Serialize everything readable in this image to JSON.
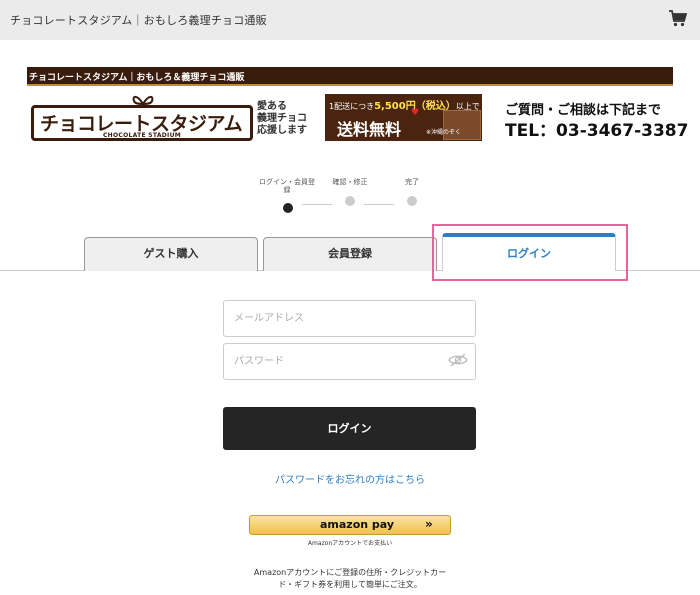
{
  "header": {
    "title": "チョコレートスタジアム｜おもしろ義理チョコ通販",
    "cart_icon": "cart-icon"
  },
  "brand": {
    "bar_text": "チョコレートスタジアム｜おもしろ＆義理チョコ通販",
    "logo_text": "チョコレートスタジアム",
    "logo_sub": "CHOCOLATE STADIUM",
    "tagline": [
      "愛ある",
      "義理チョコ",
      "応援します"
    ],
    "banner_line1": "1配送につき",
    "banner_amount": "5,500円（税込）",
    "banner_line1_suffix": "以上で",
    "banner_main": "送料無料",
    "banner_note": "※沖縄のぞく",
    "contact": "ご質問・ご相談は下記まで",
    "tel": "TEL：03-3467-3387"
  },
  "steps": [
    {
      "label": "ログイン・会員登録",
      "active": true
    },
    {
      "label": "確認・修正",
      "active": false
    },
    {
      "label": "完了",
      "active": false
    }
  ],
  "tabs": [
    {
      "label": "ゲスト購入",
      "active": false
    },
    {
      "label": "会員登録",
      "active": false
    },
    {
      "label": "ログイン",
      "active": true
    }
  ],
  "form": {
    "email_placeholder": "メールアドレス",
    "password_placeholder": "パスワード",
    "login_button": "ログイン",
    "forgot_link": "パスワードをお忘れの方はこちら"
  },
  "amazon": {
    "button_label": "amazon pay",
    "sub_label": "Amazonアカウントでお支払い",
    "note_line1": "Amazonアカウントにご登録の住所・クレジットカー",
    "note_line2": "ド・ギフト券を利用して簡単にご注文。"
  },
  "colors": {
    "accent": "#2b7fc3",
    "highlight": "#e8649a",
    "brand_brown": "#3a1c0c",
    "amazon_yellow": "#f0c14b"
  }
}
